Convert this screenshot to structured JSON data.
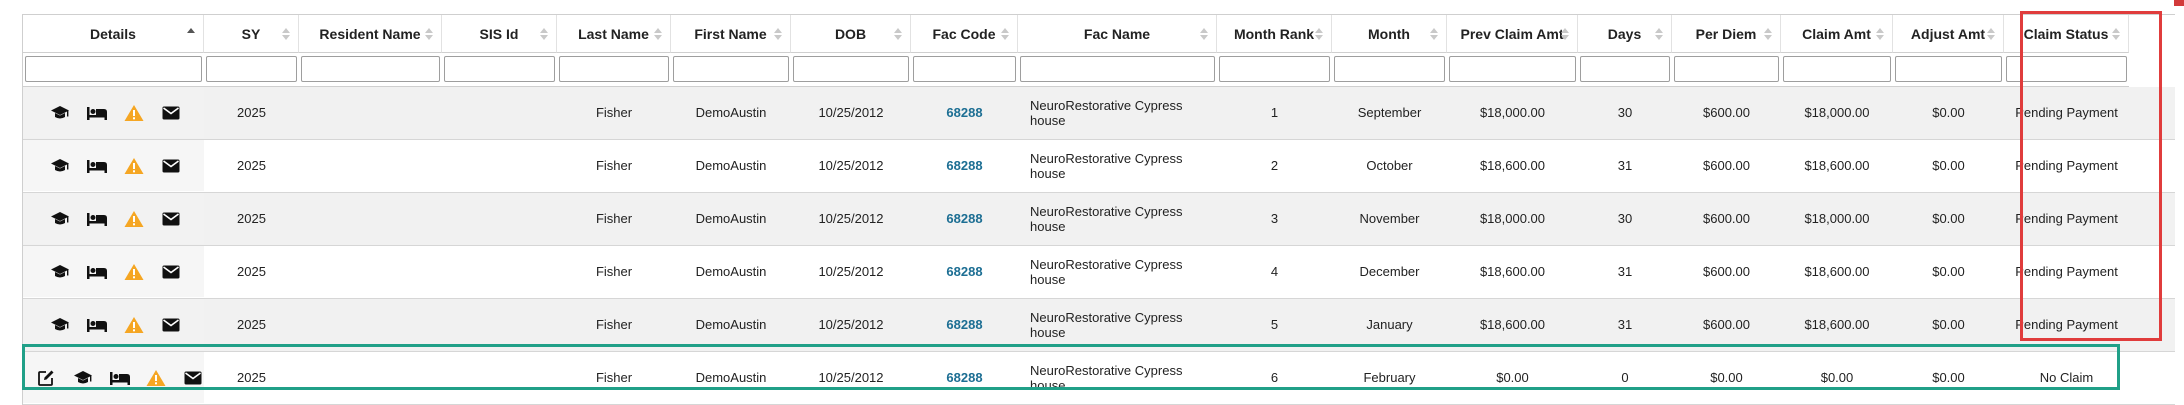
{
  "columns": [
    {
      "key": "details",
      "label": "Details",
      "sort": "asc"
    },
    {
      "key": "sy",
      "label": "SY",
      "sort": "none"
    },
    {
      "key": "resident_name",
      "label": "Resident Name",
      "sort": "none"
    },
    {
      "key": "sis_id",
      "label": "SIS Id",
      "sort": "none"
    },
    {
      "key": "last_name",
      "label": "Last Name",
      "sort": "none"
    },
    {
      "key": "first_name",
      "label": "First Name",
      "sort": "none"
    },
    {
      "key": "dob",
      "label": "DOB",
      "sort": "none"
    },
    {
      "key": "fac_code",
      "label": "Fac Code",
      "sort": "none"
    },
    {
      "key": "fac_name",
      "label": "Fac Name",
      "sort": "none"
    },
    {
      "key": "month_rank",
      "label": "Month Rank",
      "sort": "none"
    },
    {
      "key": "month",
      "label": "Month",
      "sort": "none"
    },
    {
      "key": "prev_claim_amt",
      "label": "Prev Claim Amt",
      "sort": "none"
    },
    {
      "key": "days",
      "label": "Days",
      "sort": "none"
    },
    {
      "key": "per_diem",
      "label": "Per Diem",
      "sort": "none"
    },
    {
      "key": "claim_amt",
      "label": "Claim Amt",
      "sort": "none"
    },
    {
      "key": "adjust_amt",
      "label": "Adjust Amt",
      "sort": "none"
    },
    {
      "key": "claim_status",
      "label": "Claim Status",
      "sort": "none"
    }
  ],
  "filters": {
    "details": "",
    "sy": "",
    "resident_name": "",
    "sis_id": "",
    "last_name": "",
    "first_name": "",
    "dob": "",
    "fac_code": "",
    "fac_name": "",
    "month_rank": "",
    "month": "",
    "prev_claim_amt": "",
    "days": "",
    "per_diem": "",
    "claim_amt": "",
    "adjust_amt": "",
    "claim_status": ""
  },
  "rows": [
    {
      "icons": [
        "graduation-cap-icon",
        "bed-icon",
        "warning-icon",
        "envelope-icon"
      ],
      "sy": "2025",
      "resident_name": "",
      "sis_id": "",
      "last_name": "Fisher",
      "first_name": "DemoAustin",
      "dob": "10/25/2012",
      "fac_code": "68288",
      "fac_name": "NeuroRestorative Cypress house",
      "month_rank": "1",
      "month": "September",
      "prev_claim_amt": "$18,000.00",
      "days": "30",
      "per_diem": "$600.00",
      "claim_amt": "$18,000.00",
      "adjust_amt": "$0.00",
      "claim_status": "Pending Payment"
    },
    {
      "icons": [
        "graduation-cap-icon",
        "bed-icon",
        "warning-icon",
        "envelope-icon"
      ],
      "sy": "2025",
      "resident_name": "",
      "sis_id": "",
      "last_name": "Fisher",
      "first_name": "DemoAustin",
      "dob": "10/25/2012",
      "fac_code": "68288",
      "fac_name": "NeuroRestorative Cypress house",
      "month_rank": "2",
      "month": "October",
      "prev_claim_amt": "$18,600.00",
      "days": "31",
      "per_diem": "$600.00",
      "claim_amt": "$18,600.00",
      "adjust_amt": "$0.00",
      "claim_status": "Pending Payment"
    },
    {
      "icons": [
        "graduation-cap-icon",
        "bed-icon",
        "warning-icon",
        "envelope-icon"
      ],
      "sy": "2025",
      "resident_name": "",
      "sis_id": "",
      "last_name": "Fisher",
      "first_name": "DemoAustin",
      "dob": "10/25/2012",
      "fac_code": "68288",
      "fac_name": "NeuroRestorative Cypress house",
      "month_rank": "3",
      "month": "November",
      "prev_claim_amt": "$18,000.00",
      "days": "30",
      "per_diem": "$600.00",
      "claim_amt": "$18,000.00",
      "adjust_amt": "$0.00",
      "claim_status": "Pending Payment"
    },
    {
      "icons": [
        "graduation-cap-icon",
        "bed-icon",
        "warning-icon",
        "envelope-icon"
      ],
      "sy": "2025",
      "resident_name": "",
      "sis_id": "",
      "last_name": "Fisher",
      "first_name": "DemoAustin",
      "dob": "10/25/2012",
      "fac_code": "68288",
      "fac_name": "NeuroRestorative Cypress house",
      "month_rank": "4",
      "month": "December",
      "prev_claim_amt": "$18,600.00",
      "days": "31",
      "per_diem": "$600.00",
      "claim_amt": "$18,600.00",
      "adjust_amt": "$0.00",
      "claim_status": "Pending Payment"
    },
    {
      "icons": [
        "graduation-cap-icon",
        "bed-icon",
        "warning-icon",
        "envelope-icon"
      ],
      "sy": "2025",
      "resident_name": "",
      "sis_id": "",
      "last_name": "Fisher",
      "first_name": "DemoAustin",
      "dob": "10/25/2012",
      "fac_code": "68288",
      "fac_name": "NeuroRestorative Cypress house",
      "month_rank": "5",
      "month": "January",
      "prev_claim_amt": "$18,600.00",
      "days": "31",
      "per_diem": "$600.00",
      "claim_amt": "$18,600.00",
      "adjust_amt": "$0.00",
      "claim_status": "Pending Payment"
    },
    {
      "icons": [
        "edit-icon",
        "graduation-cap-icon",
        "bed-icon",
        "warning-icon",
        "envelope-icon"
      ],
      "sy": "2025",
      "resident_name": "",
      "sis_id": "",
      "last_name": "Fisher",
      "first_name": "DemoAustin",
      "dob": "10/25/2012",
      "fac_code": "68288",
      "fac_name": "NeuroRestorative Cypress house",
      "month_rank": "6",
      "month": "February",
      "prev_claim_amt": "$0.00",
      "days": "0",
      "per_diem": "$0.00",
      "claim_amt": "$0.00",
      "adjust_amt": "$0.00",
      "claim_status": "No Claim"
    }
  ],
  "colors": {
    "link": "#1c6e93",
    "warning": "#f5a623",
    "highlight_claim_status": "#e03c3c",
    "highlight_row": "#20a088"
  }
}
